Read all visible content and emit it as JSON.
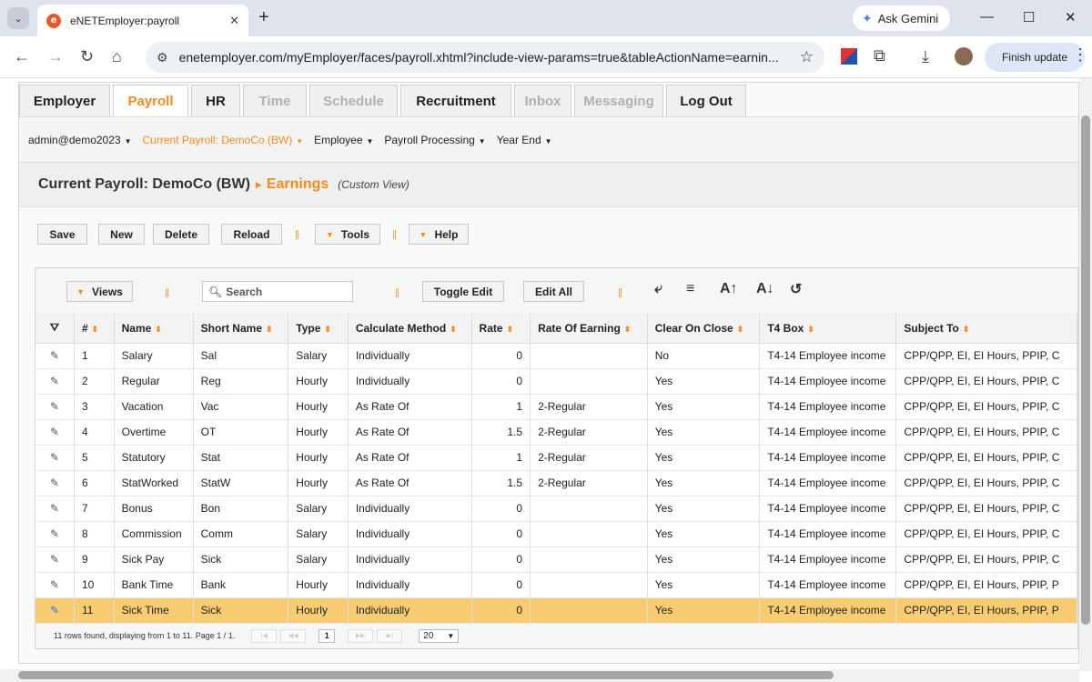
{
  "browser": {
    "tab_title": "eNETEmployer:payroll",
    "new_tab": "+",
    "gemini_label": "Ask Gemini",
    "url": "enetemployer.com/myEmployer/faces/payroll.xhtml?include-view-params=true&tableActionName=earnin...",
    "finish_update": "Finish update",
    "favicon_letter": "e"
  },
  "main_tabs": [
    {
      "label": "Employer",
      "state": "normal"
    },
    {
      "label": "Payroll",
      "state": "active"
    },
    {
      "label": "HR",
      "state": "normal"
    },
    {
      "label": "Time",
      "state": "disabled"
    },
    {
      "label": "Schedule",
      "state": "disabled"
    },
    {
      "label": "Recruitment",
      "state": "normal"
    },
    {
      "label": "Inbox",
      "state": "disabled"
    },
    {
      "label": "Messaging",
      "state": "disabled"
    },
    {
      "label": "Log Out",
      "state": "normal"
    }
  ],
  "menu": [
    {
      "label": "admin@demo2023"
    },
    {
      "label": "Current Payroll: DemoCo (BW)"
    },
    {
      "label": "Employee"
    },
    {
      "label": "Payroll Processing"
    },
    {
      "label": "Year End"
    }
  ],
  "title": {
    "main": "Current Payroll: DemoCo (BW)",
    "sub": "Earnings",
    "view": "(Custom View)"
  },
  "actions": {
    "save": "Save",
    "new": "New",
    "delete": "Delete",
    "reload": "Reload",
    "tools": "Tools",
    "help": "Help"
  },
  "grid_toolbar": {
    "views": "Views",
    "search_placeholder": "Search",
    "toggle_edit": "Toggle Edit",
    "edit_all": "Edit All"
  },
  "columns": [
    "#",
    "Name",
    "Short Name",
    "Type",
    "Calculate Method",
    "Rate",
    "Rate Of Earning",
    "Clear On Close",
    "T4 Box",
    "Subject To"
  ],
  "rows": [
    [
      "1",
      "Salary",
      "Sal",
      "Salary",
      "Individually",
      "0",
      "",
      "No",
      "T4-14 Employee income",
      "CPP/QPP, EI, EI Hours, PPIP, C"
    ],
    [
      "2",
      "Regular",
      "Reg",
      "Hourly",
      "Individually",
      "0",
      "",
      "Yes",
      "T4-14 Employee income",
      "CPP/QPP, EI, EI Hours, PPIP, C"
    ],
    [
      "3",
      "Vacation",
      "Vac",
      "Hourly",
      "As Rate Of",
      "1",
      "2-Regular",
      "Yes",
      "T4-14 Employee income",
      "CPP/QPP, EI, EI Hours, PPIP, C"
    ],
    [
      "4",
      "Overtime",
      "OT",
      "Hourly",
      "As Rate Of",
      "1.5",
      "2-Regular",
      "Yes",
      "T4-14 Employee income",
      "CPP/QPP, EI, EI Hours, PPIP, C"
    ],
    [
      "5",
      "Statutory",
      "Stat",
      "Hourly",
      "As Rate Of",
      "1",
      "2-Regular",
      "Yes",
      "T4-14 Employee income",
      "CPP/QPP, EI, EI Hours, PPIP, C"
    ],
    [
      "6",
      "StatWorked",
      "StatW",
      "Hourly",
      "As Rate Of",
      "1.5",
      "2-Regular",
      "Yes",
      "T4-14 Employee income",
      "CPP/QPP, EI, EI Hours, PPIP, C"
    ],
    [
      "7",
      "Bonus",
      "Bon",
      "Salary",
      "Individually",
      "0",
      "",
      "Yes",
      "T4-14 Employee income",
      "CPP/QPP, EI, EI Hours, PPIP, C"
    ],
    [
      "8",
      "Commission",
      "Comm",
      "Salary",
      "Individually",
      "0",
      "",
      "Yes",
      "T4-14 Employee income",
      "CPP/QPP, EI, EI Hours, PPIP, C"
    ],
    [
      "9",
      "Sick Pay",
      "Sick",
      "Salary",
      "Individually",
      "0",
      "",
      "Yes",
      "T4-14 Employee income",
      "CPP/QPP, EI, EI Hours, PPIP, C"
    ],
    [
      "10",
      "Bank Time",
      "Bank",
      "Hourly",
      "Individually",
      "0",
      "",
      "Yes",
      "T4-14 Employee income",
      "CPP/QPP, EI, EI Hours, PPIP, P"
    ],
    [
      "11",
      "Sick Time",
      "Sick",
      "Hourly",
      "Individually",
      "0",
      "",
      "Yes",
      "T4-14 Employee income",
      "CPP/QPP, EI, EI Hours, PPIP, P"
    ]
  ],
  "selected_row": 11,
  "pager": {
    "summary": "11 rows found, displaying from 1 to 11. Page 1 / 1.",
    "first": "|◀",
    "prev": "◀◀",
    "current": "1",
    "next": "▶▶",
    "last": "▶|",
    "page_size": "20"
  },
  "colors": {
    "accent": "#f08b1d",
    "selected_row": "#f8cd71"
  }
}
